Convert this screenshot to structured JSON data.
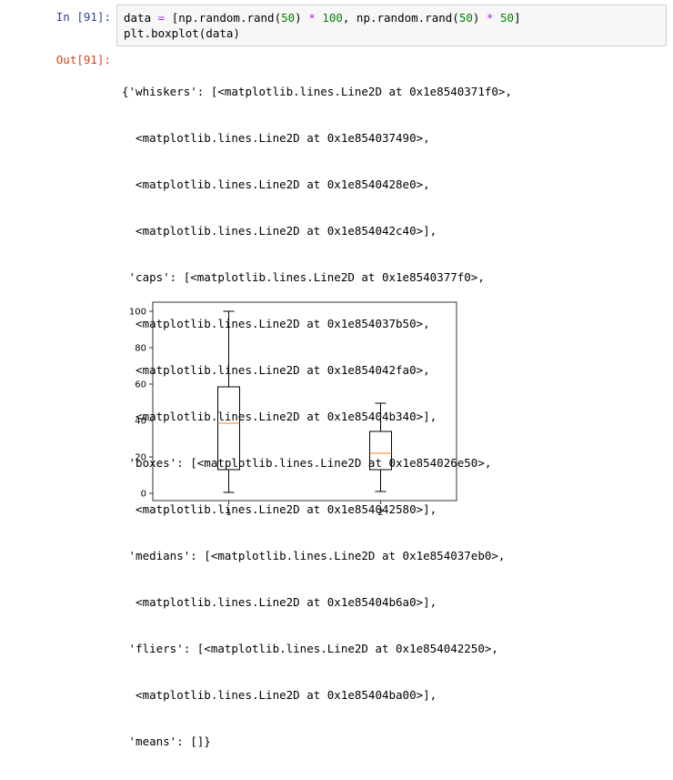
{
  "input_cell": {
    "prompt": "In [91]:",
    "code_line1_parts": [
      "data ",
      "=",
      " [np.random.rand(",
      "50",
      ") ",
      "*",
      " ",
      "100",
      ", np.random.rand(",
      "50",
      ") ",
      "*",
      " ",
      "50",
      "]"
    ],
    "code_line2": "plt.boxplot(data)"
  },
  "output_cell": {
    "prompt": "Out[91]:",
    "lines": [
      "{'whiskers': [<matplotlib.lines.Line2D at 0x1e8540371f0>,",
      "  <matplotlib.lines.Line2D at 0x1e854037490>,",
      "  <matplotlib.lines.Line2D at 0x1e8540428e0>,",
      "  <matplotlib.lines.Line2D at 0x1e854042c40>],",
      " 'caps': [<matplotlib.lines.Line2D at 0x1e8540377f0>,",
      "  <matplotlib.lines.Line2D at 0x1e854037b50>,",
      "  <matplotlib.lines.Line2D at 0x1e854042fa0>,",
      "  <matplotlib.lines.Line2D at 0x1e85404b340>],",
      " 'boxes': [<matplotlib.lines.Line2D at 0x1e854026e50>,",
      "  <matplotlib.lines.Line2D at 0x1e854042580>],",
      " 'medians': [<matplotlib.lines.Line2D at 0x1e854037eb0>,",
      "  <matplotlib.lines.Line2D at 0x1e85404b6a0>],",
      " 'fliers': [<matplotlib.lines.Line2D at 0x1e854042250>,",
      "  <matplotlib.lines.Line2D at 0x1e85404ba00>],",
      " 'means': []}"
    ]
  },
  "colors": {
    "in_prompt": "#303f9f",
    "out_prompt": "#d84315",
    "median": "#ff7f0e",
    "box": "#000000"
  },
  "chart_data": {
    "type": "boxplot",
    "categories": [
      "1",
      "2"
    ],
    "boxes": [
      {
        "label": "1",
        "min": 0.5,
        "q1": 13,
        "median": 38.5,
        "q3": 58.5,
        "max": 100
      },
      {
        "label": "2",
        "min": 1,
        "q1": 13,
        "median": 22,
        "q3": 34,
        "max": 49.5
      }
    ],
    "yticks": [
      0,
      20,
      40,
      60,
      80,
      100
    ],
    "ylim": [
      -4,
      105
    ],
    "xlim": [
      0.5,
      2.5
    ],
    "grid": false
  }
}
